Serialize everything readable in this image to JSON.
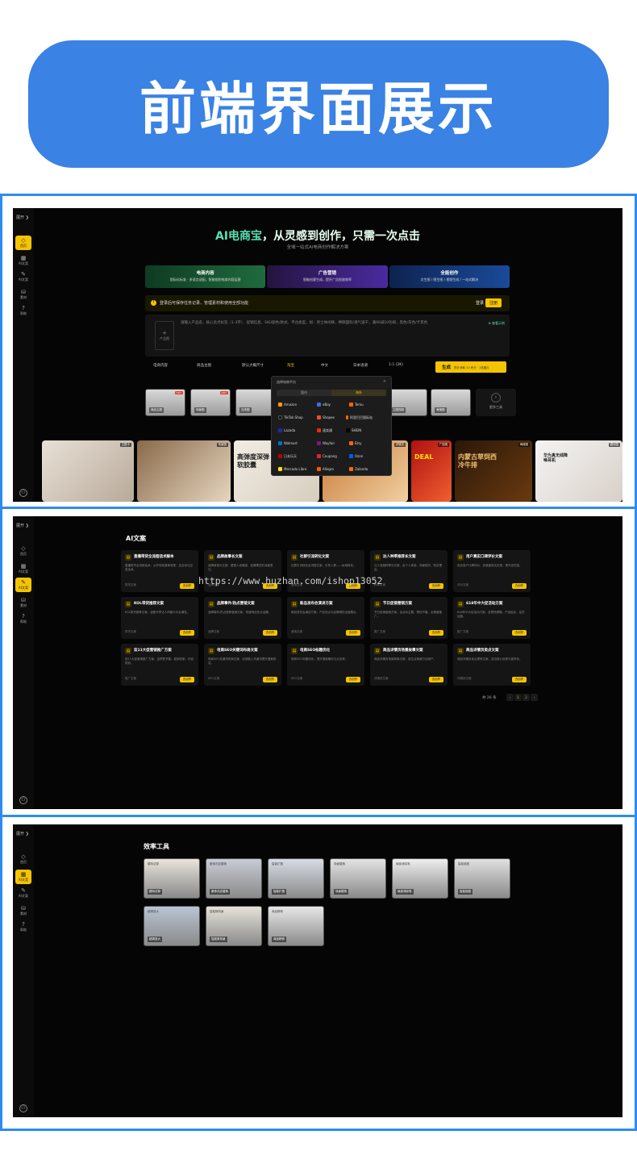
{
  "banner": {
    "title": "前端界面展示"
  },
  "sidebar": {
    "top": "展开 ❯",
    "items": [
      "首页",
      "AI文案",
      "AI文案",
      "素材",
      "帮助"
    ],
    "avatar": "⚇"
  },
  "screen1": {
    "hero_ai": "AI电商宝",
    "hero_rest": "，从灵感到创作，只需一次点击",
    "subtitle": "全域一站式AI电商创作解决方案",
    "tabs": [
      {
        "title": "电商内容",
        "desc": "国际化标准 · 多语言适配，智能规划电商内容运营"
      },
      {
        "title": "广告营销",
        "desc": "智能创意生成，提升广告投放效率"
      },
      {
        "title": "全能创作",
        "desc": "文生图 / 图生图 / 视频生成 / 一站式解决"
      }
    ],
    "login_text": "登录后可保存任务记录、管理素材和使用全部功能",
    "login_btn": "登录",
    "register_btn": "注册",
    "upload_label": "产品图",
    "placeholder": "请输入产品名、核心卖点标签（1-3字）、促销信息、SKU颜色/款式、平台类型，如：男士休闲裤，棉麻面料/透气速干，满99减10包邮，黑色/灰色/卡其色",
    "check_link": "⊕ 查看示例",
    "options": [
      "电商内容",
      "商品主图",
      "默认大概尺寸",
      "淘宝",
      "中文",
      "日本语调",
      "1:1 (2K)"
    ],
    "generate": "生成",
    "generate_hint": "预计消耗 10 积分 · 1张图片",
    "thumbs": [
      "商品主图",
      "场景图",
      "白底图",
      "细节图",
      "详情页",
      "模特图",
      "卖点图",
      "主图视频",
      "海报图"
    ],
    "more_tools": "更多工具",
    "strip": [
      {
        "tag": "主图卡"
      },
      {
        "tag": "场景图"
      },
      {
        "tag": "白底图",
        "text": "高弹度深弹软胶囊"
      },
      {
        "tag": "详情页"
      },
      {
        "tag": "广告图",
        "text": "DEAL"
      },
      {
        "tag": "海报图",
        "text": "内蒙古草饲西冷牛排"
      },
      {
        "tag": "模特图",
        "text": "华为真无线降噪耳机"
      }
    ],
    "popup": {
      "title": "选择电商平台",
      "tab_domestic": "国内",
      "tab_overseas": "海外",
      "platforms": [
        "Amazon",
        "eBay",
        "Temu",
        "TikTok Shop",
        "Shopee",
        "阿里巴巴国际站",
        "Lazada",
        "速卖通",
        "SHEIN",
        "Walmart",
        "Wayfair",
        "Etsy",
        "日本乐天",
        "Coupang",
        "Ozon",
        "Mercado Libre",
        "Allegro",
        "Zalando"
      ]
    }
  },
  "screen2": {
    "title": "AI文案",
    "cards": [
      {
        "t": "直播带货全流程话术脚本",
        "d": "直播带货全流程话术，从开场到逼单收尾，含互动与应急话术。",
        "c": "带货文案"
      },
      {
        "t": "品牌故事长文案",
        "d": "品牌故事长文案，塑造人设情感，品牌理念的深度表达。",
        "c": "品牌文案"
      },
      {
        "t": "社群引流转化文案",
        "d": "社群引流转化全流程文案，引导入群——私域转化。",
        "c": "营销文案"
      },
      {
        "t": "达人种草推荐长文案",
        "d": "达人深度种草长文案，含个人体验、场景描写、购买理由。",
        "c": "种草文案"
      },
      {
        "t": "用户真实口碑评价文案",
        "d": "真实用户口碑评价，多维度真实反馈，提升信任感。",
        "c": "评价文案"
      },
      {
        "t": "KOL带货推荐文案",
        "d": "KOL带货推荐文案，适配不同达人风格与平台调性。",
        "c": "带货文案"
      },
      {
        "t": "品牌事件/热点营销文案",
        "d": "品牌事件/热点借势营销文案，快速响应热点话题。",
        "c": "品牌文案"
      },
      {
        "t": "新品发布会演讲方案",
        "d": "新品发布会演讲方案，产品亮点与品牌调性全面展示。",
        "c": "营销文案"
      },
      {
        "t": "节日促销营销方案",
        "d": "节日促销营销方案，含活动主题、预热节奏、全渠道推广。",
        "c": "推广文案"
      },
      {
        "t": "618年中大促活动方案",
        "d": "618年中大促活动方案，含预热策略、产品组合、会员运营。",
        "c": "推广文案"
      },
      {
        "t": "双11大促营销推广方案",
        "d": "双11大促营销推广方案，含预售节奏、促销机制、内容规划。",
        "c": "推广文案"
      },
      {
        "t": "电商SEO关键词布局文案",
        "d": "电商SEO关键词布局文案，自然融入关键词提升搜索排名。",
        "c": "SEO文案"
      },
      {
        "t": "电商SEO标题优化",
        "d": "电商SEO标题优化，提升搜索曝光与点击率。",
        "c": "SEO文案"
      },
      {
        "t": "商品详情页场景故事文案",
        "d": "商品详情页场景故事文案，用生活场景打动用户。",
        "c": "详情页文案"
      },
      {
        "t": "商品详情页卖点文案",
        "d": "商品详情页卖点提炼文案，突出核心优势与差异化。",
        "c": "详情页文案"
      }
    ],
    "card_btn": "去创作",
    "pager_total": "共 26 条",
    "pager_prev": "‹",
    "pager_pages": [
      "1",
      "2"
    ],
    "pager_next": "›",
    "watermark": "https://www.huzhan.com/ishop13052"
  },
  "screen3": {
    "title": "效率工具",
    "tools": [
      {
        "top": "模特试穿",
        "label": "模特试穿"
      },
      {
        "top": "服饰花纹替换",
        "label": "服饰花纹替换"
      },
      {
        "top": "智能扩图",
        "label": "智能扩图"
      },
      {
        "top": "场景替换",
        "label": "场景替换"
      },
      {
        "top": "局部消除笔",
        "label": "局部消除笔"
      },
      {
        "top": "智能抠图",
        "label": "智能抠图"
      },
      {
        "top": "超清放大",
        "label": "超清放大"
      },
      {
        "top": "智能换背景",
        "label": "智能换背景"
      },
      {
        "top": "商品精修",
        "label": "商品精修"
      }
    ]
  },
  "colors": {
    "accent": "#f5c400",
    "banner": "#3a82e4",
    "frame": "#2d8cf0"
  }
}
